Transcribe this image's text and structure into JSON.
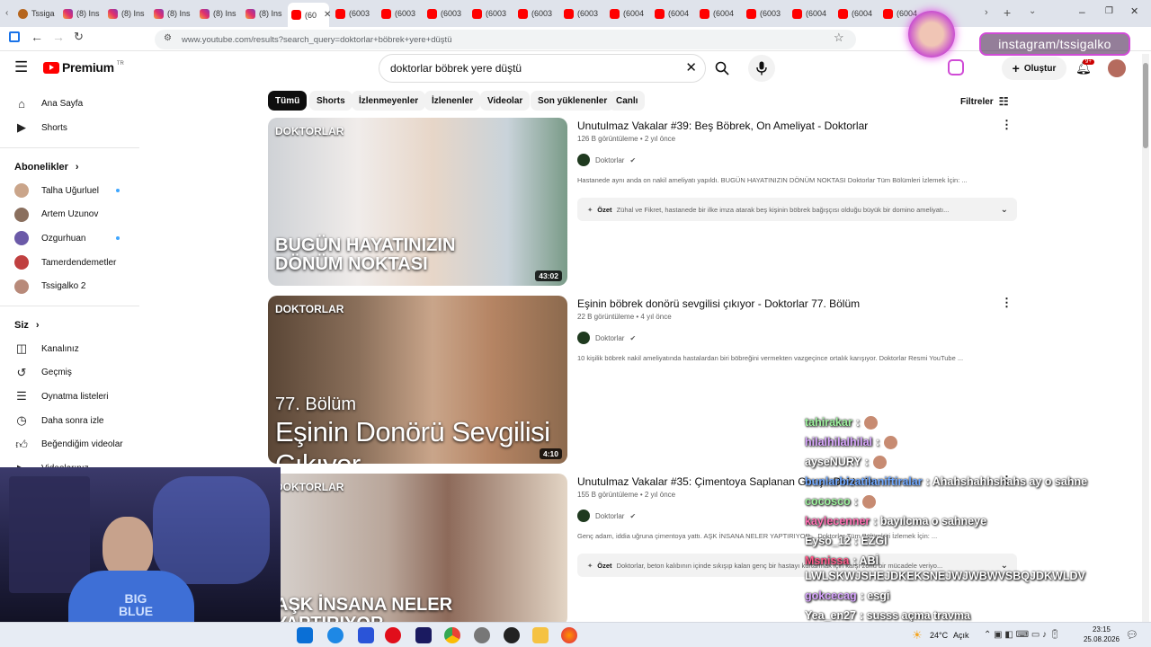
{
  "browser": {
    "tabs": [
      {
        "label": "Tssiga",
        "kind": "tw"
      },
      {
        "label": "(8) Ins",
        "kind": "ig"
      },
      {
        "label": "(8) Ins",
        "kind": "ig"
      },
      {
        "label": "(8) Ins",
        "kind": "ig"
      },
      {
        "label": "(8) Ins",
        "kind": "ig"
      },
      {
        "label": "(8) Ins",
        "kind": "ig"
      },
      {
        "label": "(60",
        "kind": "yt",
        "active": true
      },
      {
        "label": "(6003",
        "kind": "yt"
      },
      {
        "label": "(6003",
        "kind": "yt"
      },
      {
        "label": "(6003",
        "kind": "yt"
      },
      {
        "label": "(6003",
        "kind": "yt"
      },
      {
        "label": "(6003",
        "kind": "yt"
      },
      {
        "label": "(6003",
        "kind": "yt"
      },
      {
        "label": "(6004",
        "kind": "yt"
      },
      {
        "label": "(6004",
        "kind": "yt"
      },
      {
        "label": "(6004",
        "kind": "yt"
      },
      {
        "label": "(6003",
        "kind": "yt"
      },
      {
        "label": "(6004",
        "kind": "yt"
      },
      {
        "label": "(6004",
        "kind": "yt"
      },
      {
        "label": "(6004",
        "kind": "yt"
      }
    ],
    "url": "www.youtube.com/results?search_query=doktorlar+böbrek+yere+düştü"
  },
  "header": {
    "logo_text": "Premium",
    "logo_sup": "TR",
    "search_value": "doktorlar böbrek yere düştü",
    "create_label": "Oluştur",
    "notif_count": "9+"
  },
  "overlay_badge": "instagram/tssigalko",
  "chips": [
    "Tümü",
    "Shorts",
    "İzlenmeyenler",
    "İzlenenler",
    "Videolar",
    "Son yüklenenler",
    "Canlı"
  ],
  "filters_label": "Filtreler",
  "sidebar": {
    "main": [
      {
        "label": "Ana Sayfa",
        "icon": "home-icon"
      },
      {
        "label": "Shorts",
        "icon": "shorts-icon"
      }
    ],
    "subs_title": "Abonelikler",
    "subs": [
      {
        "label": "Talha Uğurluel",
        "dot": true
      },
      {
        "label": "Artem Uzunov",
        "dot": false
      },
      {
        "label": "Ozgurhuan",
        "dot": true
      },
      {
        "label": "Tamerdendemetler",
        "dot": false
      },
      {
        "label": "Tssigalko 2",
        "dot": false
      }
    ],
    "you_title": "Siz",
    "you": [
      {
        "label": "Kanalınız",
        "icon": "channel-icon"
      },
      {
        "label": "Geçmiş",
        "icon": "history-icon"
      },
      {
        "label": "Oynatma listeleri",
        "icon": "playlist-icon"
      },
      {
        "label": "Daha sonra izle",
        "icon": "clock-icon"
      },
      {
        "label": "Beğendiğim videolar",
        "icon": "like-icon"
      },
      {
        "label": "Videolarınız",
        "icon": "video-icon"
      }
    ]
  },
  "results": [
    {
      "title": "Unutulmaz Vakalar #39: Beş Böbrek, On Ameliyat - Doktorlar",
      "meta": "126 B görüntüleme • 2 yıl önce",
      "channel": "Doktorlar",
      "desc": "Hastanede aynı anda on nakil ameliyatı yapıldı. BUGÜN HAYATINIZIN DÖNÜM NOKTASI Doktorlar Tüm Bölümleri İzlemek İçin: ...",
      "ozet_label": "Özet",
      "ozet": "Zühal ve Fikret, hastanede bir ilke imza atarak beş kişinin böbrek bağışçısı olduğu büyük bir domino ameliyatı...",
      "duration": "43:02",
      "thumb_brand": "DOKTORLAR",
      "thumb_text": "BUGÜN HAYATINIZIN DÖNÜM NOKTASI"
    },
    {
      "title": "Eşinin böbrek donörü sevgilisi çıkıyor - Doktorlar 77. Bölüm",
      "meta": "22 B görüntüleme • 4 yıl önce",
      "channel": "Doktorlar",
      "desc": "10 kişilik böbrek nakil ameliyatında hastalardan biri böbreğini vermekten vazgeçince ortalık karışıyor. Doktorlar Resmi YouTube ...",
      "ozet_label": "",
      "ozet": "",
      "duration": "4:10",
      "thumb_brand": "DOKTORLAR",
      "thumb_text": "Eşinin Donörü Sevgilisi Çıkıyor",
      "thumb_sub": "77. Bölüm"
    },
    {
      "title": "Unutulmaz Vakalar #35: Çimentoya Saplanan Genç - Doktorlar",
      "meta": "155 B görüntüleme • 2 yıl önce",
      "channel": "Doktorlar",
      "desc": "Genç adam, iddia uğruna çimentoya yattı. AŞK İNSANA NELER YAPTIRIYOR... Doktorlar Tüm Bölümleri İzlemek İçin: ...",
      "ozet_label": "Özet",
      "ozet": "Doktorlar, beton kalıbının içinde sıkışıp kalan genç bir hastayı kurtarmak için karşı zorlu bir mücadele veriyo...",
      "duration": "",
      "thumb_brand": "DOKTORLAR",
      "thumb_text": "AŞK İNSANA NELER YAPTIRIYOR"
    }
  ],
  "chat": [
    {
      "user": "tahirakar",
      "msg": ":",
      "color": "#9ef29e"
    },
    {
      "user": "hilalhilalhilal",
      "msg": ":",
      "color": "#d9a6ff"
    },
    {
      "user": "ayseNURY",
      "msg": ":",
      "color": "#ffffff"
    },
    {
      "user": "bunlarbizatilaniftiralar",
      "msg": ": Ahahshahhshahs ay o sahne",
      "color": "#6fa8ff"
    },
    {
      "user": "cocosco",
      "msg": ":",
      "color": "#9ef29e"
    },
    {
      "user": "kaylecenner",
      "msg": ": bayılcma o sahneye",
      "color": "#ff6fb2"
    },
    {
      "user": "Eyso_12",
      "msg": ": EZGİ",
      "color": "#ffffff"
    },
    {
      "user": "Msnissa",
      "msg": ": ABİ",
      "color": "#ff5a8a"
    },
    {
      "user": "",
      "msg": "LWLSKWJSHEJDKEKSNEJWJWBWVSBQJDKWLDV",
      "color": "#ffffff"
    },
    {
      "user": "gokcecag",
      "msg": ": esgi",
      "color": "#d9a6ff"
    },
    {
      "user": "Yea_en27",
      "msg": ": susss açma travma",
      "color": "#ffffff"
    }
  ],
  "webcam_shirt": "BIG BLUE",
  "taskbar": {
    "weather": "24°C",
    "weather_desc": "Açık",
    "time": "23:15",
    "date": "25.08.2026"
  }
}
